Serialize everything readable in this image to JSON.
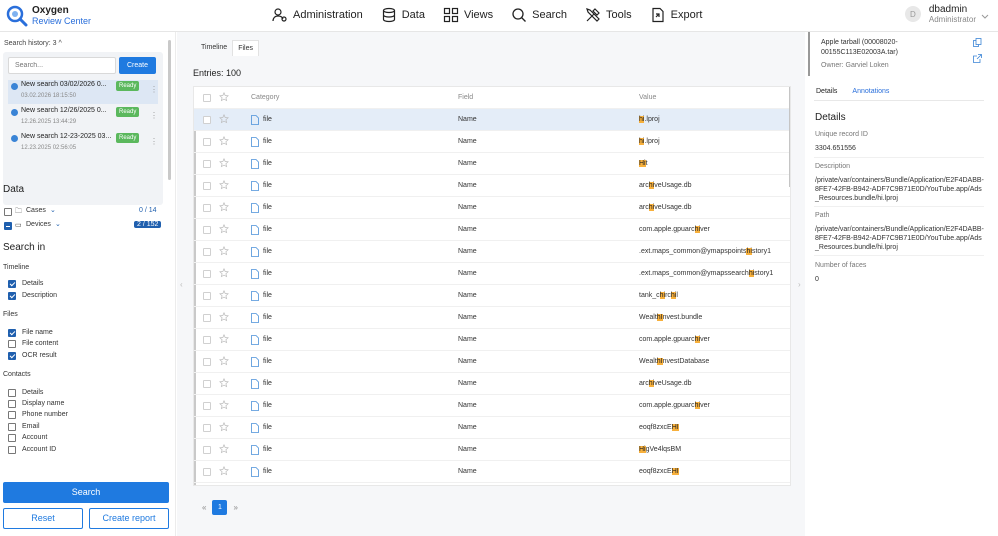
{
  "app": {
    "name_line1": "Oxygen",
    "name_line2": "Review Center"
  },
  "nav": [
    {
      "label": "Administration",
      "icon": "users-gear-icon"
    },
    {
      "label": "Data",
      "icon": "database-icon"
    },
    {
      "label": "Views",
      "icon": "views-grid-icon"
    },
    {
      "label": "Search",
      "icon": "search-icon"
    },
    {
      "label": "Tools",
      "icon": "tools-icon"
    },
    {
      "label": "Export",
      "icon": "export-icon"
    }
  ],
  "user": {
    "avatar": "D",
    "name": "dbadmin",
    "role": "Administrator"
  },
  "left": {
    "search_history_title": "Search history: 3 ^",
    "search_placeholder": "Search...",
    "create_label": "Create",
    "history": [
      {
        "title": "New search 03/02/2026 0...",
        "date": "03.02.2026 18:15:50",
        "status": "Ready"
      },
      {
        "title": "New search 12/26/2025 0...",
        "date": "12.26.2025 13:44:29",
        "status": "Ready"
      },
      {
        "title": "New search 12-23-2025 03...",
        "date": "12.23.2025 02:56:05",
        "status": "Ready"
      }
    ],
    "data_title": "Data",
    "cases_label": "Cases",
    "cases_count": "0 / 14",
    "devices_label": "Devices",
    "devices_count": "2 / 152",
    "search_in_title": "Search in",
    "timeline_title": "Timeline",
    "timeline_details": "Details",
    "timeline_description": "Description",
    "files_title": "Files",
    "files_name": "File name",
    "files_content": "File content",
    "files_ocr": "OCR result",
    "contacts_title": "Contacts",
    "contacts": [
      "Details",
      "Display name",
      "Phone number",
      "Email",
      "Account",
      "Account ID"
    ],
    "search_btn": "Search",
    "reset_btn": "Reset",
    "report_btn": "Create report"
  },
  "center": {
    "tabs": [
      "Timeline",
      "Files"
    ],
    "entries": "Entries: 100",
    "columns": {
      "category": "Category",
      "field": "Field",
      "value": "Value"
    },
    "rows": [
      {
        "category": "file",
        "field": "Name",
        "pre": "",
        "hl": "hi",
        "post": ".lproj"
      },
      {
        "category": "file",
        "field": "Name",
        "pre": "",
        "hl": "hi",
        "post": ".lproj"
      },
      {
        "category": "file",
        "field": "Name",
        "pre": "",
        "hl": "Hi",
        "post": "t"
      },
      {
        "category": "file",
        "field": "Name",
        "pre": "arc",
        "hl": "hi",
        "post": "veUsage.db"
      },
      {
        "category": "file",
        "field": "Name",
        "pre": "arc",
        "hl": "hi",
        "post": "veUsage.db"
      },
      {
        "category": "file",
        "field": "Name",
        "pre": "com.apple.gpuarc",
        "hl": "hi",
        "post": "ver"
      },
      {
        "category": "file",
        "field": "Name",
        "pre": ".ext.maps_common@ymapspoints",
        "hl": "hi",
        "post": "story1"
      },
      {
        "category": "file",
        "field": "Name",
        "pre": ".ext.maps_common@ymapssearch",
        "hl": "hi",
        "post": "story1"
      },
      {
        "category": "file",
        "field": "Name",
        "pre": "tank_c",
        "hl": "hi",
        "post": "rc",
        "hl2": "hi",
        "post2": "l"
      },
      {
        "category": "file",
        "field": "Name",
        "pre": "Wealt",
        "hl": "hI",
        "post": "nvest.bundle"
      },
      {
        "category": "file",
        "field": "Name",
        "pre": "com.apple.gpuarc",
        "hl": "hi",
        "post": "ver"
      },
      {
        "category": "file",
        "field": "Name",
        "pre": "Wealt",
        "hl": "hI",
        "post": "nvestDatabase"
      },
      {
        "category": "file",
        "field": "Name",
        "pre": "arc",
        "hl": "hi",
        "post": "veUsage.db"
      },
      {
        "category": "file",
        "field": "Name",
        "pre": "com.apple.gpuarc",
        "hl": "hi",
        "post": "ver"
      },
      {
        "category": "file",
        "field": "Name",
        "pre": "eoqf8zxcE",
        "hl": "HI",
        "post": ""
      },
      {
        "category": "file",
        "field": "Name",
        "pre": "",
        "hl": "Hi",
        "post": "gVe4lqsBM"
      },
      {
        "category": "file",
        "field": "Name",
        "pre": "eoqf8zxcE",
        "hl": "HI",
        "post": ""
      },
      {
        "category": "file",
        "field": "Name",
        "pre": "com.apple.gpuarc",
        "hl": "hi",
        "post": "ver"
      }
    ],
    "page": "1"
  },
  "right": {
    "title": "Apple tarball (00008020-00155C113E02003A.tar)",
    "owner": "Owner: Garviel Loken",
    "tabs": [
      "Details",
      "Annotations"
    ],
    "details_title": "Details",
    "fields": [
      {
        "label": "Unique record ID",
        "value": "3304.651556"
      },
      {
        "label": "Description",
        "value": "/private/var/containers/Bundle/Application/E2F4DABB-8FE7-42FB-B942-ADF7C9B71E0D/YouTube.app/Ads_Resources.bundle/hi.lproj"
      },
      {
        "label": "Path",
        "value": "/private/var/containers/Bundle/Application/E2F4DABB-8FE7-42FB-B942-ADF7C9B71E0D/YouTube.app/Ads_Resources.bundle/hi.lproj"
      },
      {
        "label": "Number of faces",
        "value": "0"
      }
    ]
  }
}
